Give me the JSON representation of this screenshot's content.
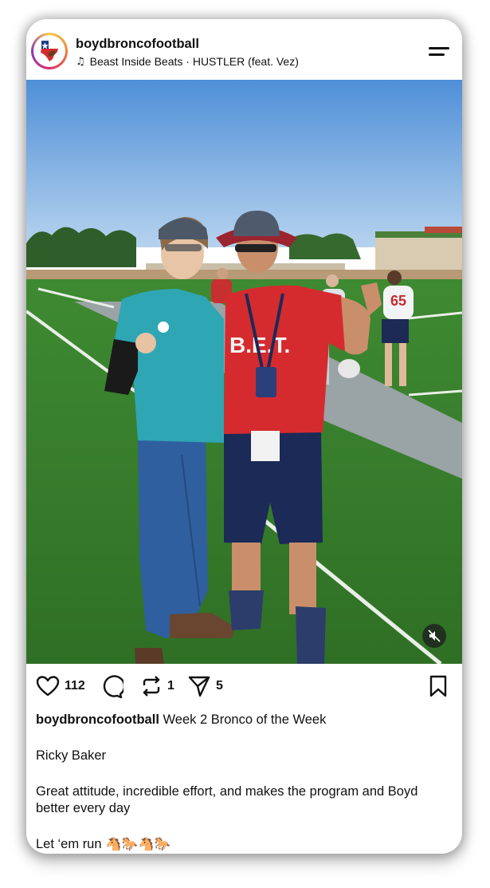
{
  "post": {
    "username": "boydbroncofootball",
    "audio": "Beast Inside Beats · HUSTLER (feat. Vez)",
    "avatar_icon": "texas-star-logo-icon",
    "menu_icon": "menu-icon"
  },
  "media": {
    "description_icon": "photo",
    "mute_icon": "speaker-muted-icon"
  },
  "actions": {
    "likes": "112",
    "reposts": "1",
    "shares": "5",
    "icons": [
      "heart-icon",
      "comment-icon",
      "repost-icon",
      "share-icon",
      "bookmark-icon"
    ]
  },
  "caption": {
    "username": "boydbroncofootball",
    "headline": "Week 2 Bronco of the Week",
    "name": "Ricky Baker",
    "body": "Great attitude, incredible effort, and makes the program and Boyd better every day",
    "closing": "Let ‘em run 🐴🐎🐴🐎"
  },
  "colors": {
    "accent_red": "#d52b2f",
    "text": "#111111"
  }
}
